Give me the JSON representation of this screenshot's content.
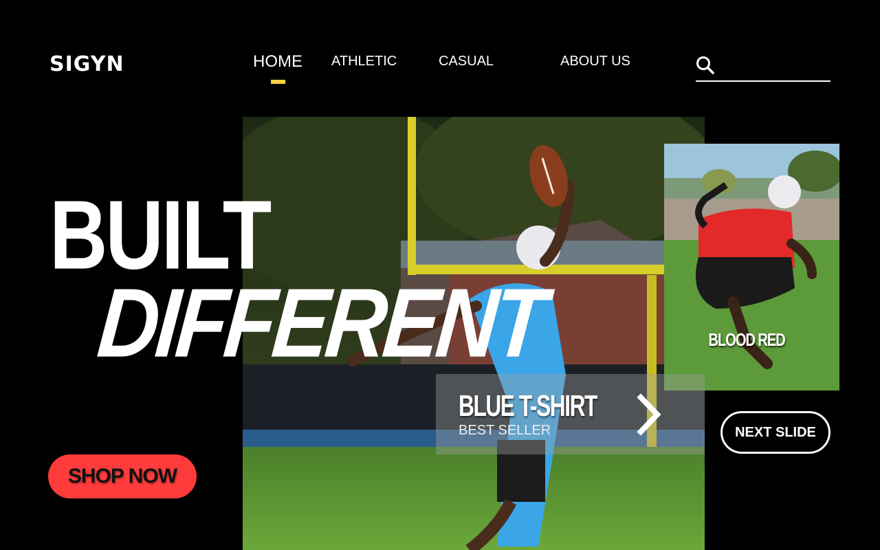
{
  "brand": {
    "logo_text": "SIGYN"
  },
  "nav": {
    "items": [
      {
        "label": "HOME",
        "active": true
      },
      {
        "label": "ATHLETIC",
        "active": false
      },
      {
        "label": "CASUAL",
        "active": false
      },
      {
        "label": "ABOUT US",
        "active": false
      }
    ],
    "active_indicator_color": "#f5d33c"
  },
  "search": {
    "icon": "search-icon",
    "value": "",
    "placeholder": ""
  },
  "hero": {
    "headline_line1": "BUILT",
    "headline_line2": "DIFFERENT",
    "image": "football player in blue t-shirt catching ball on field"
  },
  "featured_product": {
    "name": "BLUE T-SHIRT",
    "subtitle": "BEST SELLER",
    "arrow_icon": "chevron-right-icon"
  },
  "side_product": {
    "name": "BLOOD RED",
    "image": "player in red t-shirt jumping on field"
  },
  "buttons": {
    "next_slide": "NEXT SLIDE",
    "shop_now": "SHOP NOW"
  },
  "colors": {
    "background": "#000000",
    "shop_button": "#ff3b3b",
    "accent_yellow": "#f5d33c"
  }
}
